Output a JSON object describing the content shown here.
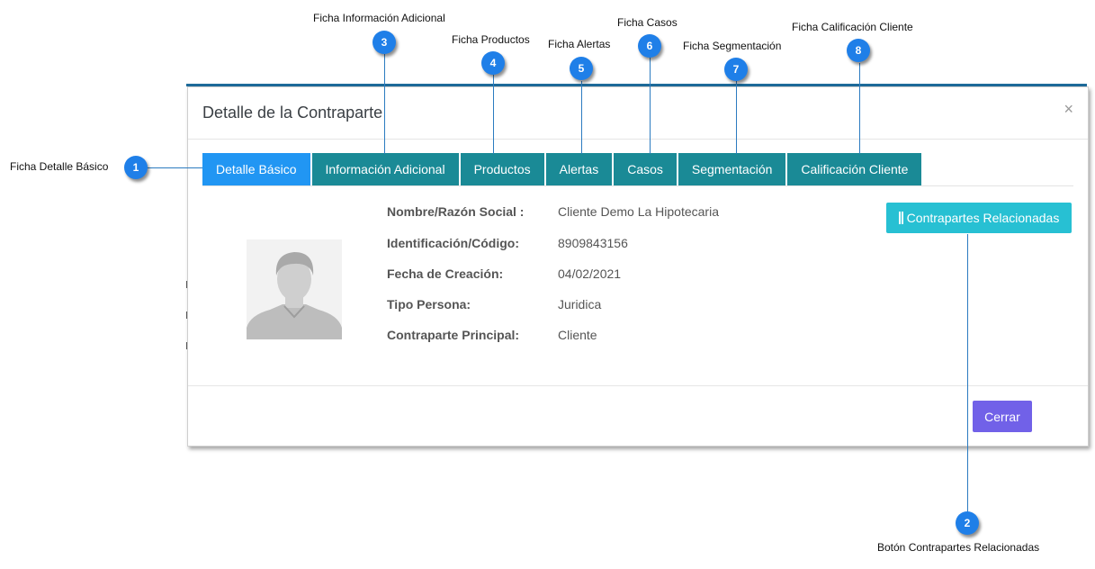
{
  "modal": {
    "title": "Detalle de la Contraparte",
    "close_symbol": "×",
    "tabs": [
      {
        "label": "Detalle Básico",
        "active": true
      },
      {
        "label": "Información Adicional",
        "active": false
      },
      {
        "label": "Productos",
        "active": false
      },
      {
        "label": "Alertas",
        "active": false
      },
      {
        "label": "Casos",
        "active": false
      },
      {
        "label": "Segmentación",
        "active": false
      },
      {
        "label": "Calificación Cliente",
        "active": false
      }
    ],
    "fields": [
      {
        "label": "Nombre/Razón Social :",
        "value": "Cliente Demo La Hipotecaria"
      },
      {
        "label": "Identificación/Código:",
        "value": "8909843156"
      },
      {
        "label": "Fecha de Creación:",
        "value": "04/02/2021"
      },
      {
        "label": "Tipo Persona:",
        "value": "Juridica"
      },
      {
        "label": "Contraparte Principal:",
        "value": "Cliente"
      }
    ],
    "related_button": "Contrapartes Relacionadas",
    "close_button": "Cerrar"
  },
  "callouts": [
    {
      "number": "1",
      "label": "Ficha Detalle Básico"
    },
    {
      "number": "2",
      "label": "Botón  Contrapartes Relacionadas"
    },
    {
      "number": "3",
      "label": "Ficha Información Adicional"
    },
    {
      "number": "4",
      "label": "Ficha Productos"
    },
    {
      "number": "5",
      "label": "Ficha Alertas"
    },
    {
      "number": "6",
      "label": "Ficha Casos"
    },
    {
      "number": "7",
      "label": "Ficha Segmentación"
    },
    {
      "number": "8",
      "label": "Ficha Calificación Cliente"
    }
  ],
  "colors": {
    "tab": "#1a8a96",
    "tab_active": "#2196f3",
    "related_button": "#27c0d3",
    "close_button": "#7161e8",
    "badge": "#1f7fe8"
  },
  "icons": [
    "close-icon",
    "columns-icon",
    "avatar-placeholder-icon"
  ]
}
